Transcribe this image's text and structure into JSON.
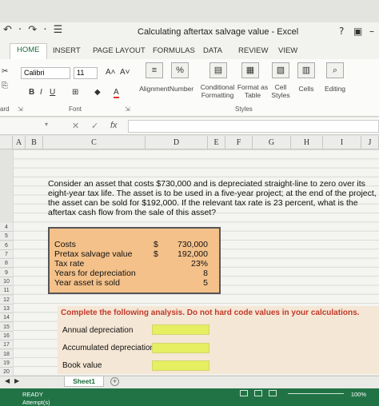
{
  "window": {
    "title": "Calculating aftertax salvage value - Excel",
    "help": "?",
    "qat_glyphs": "↶ · ↷ · ☰"
  },
  "ribbon": {
    "tabs": [
      "HOME",
      "INSERT",
      "PAGE LAYOUT",
      "FORMULAS",
      "DATA",
      "REVIEW",
      "VIEW"
    ],
    "font_name": "Calibri",
    "font_size": "11",
    "bold": "B",
    "italic": "I",
    "underline": "U",
    "grow_font": "A˄",
    "shrink_font": "A˅",
    "font_color": "A",
    "alignment": "Alignment",
    "number": "Number",
    "percent": "%",
    "conditional_formatting": "Conditional Formatting",
    "format_as_table": "Format as Table",
    "cell_styles": "Cell Styles",
    "cells": "Cells",
    "editing": "Editing",
    "group_font": "Font",
    "group_styles": "Styles",
    "group_clipboard": "ard"
  },
  "formula_bar": {
    "cancel": "✕",
    "enter": "✓",
    "fx": "fx"
  },
  "columns": [
    "A",
    "B",
    "C",
    "D",
    "E",
    "F",
    "G",
    "H",
    "I",
    "J"
  ],
  "rows": [
    "4",
    "5",
    "6",
    "7",
    "8",
    "9",
    "10",
    "11",
    "12",
    "13",
    "14",
    "15",
    "16",
    "17",
    "18",
    "19",
    "20"
  ],
  "problem_text": "Consider an asset that costs $730,000 and is depreciated straight-line to zero over its eight-year tax life. The asset is to be used in a five-year project; at the end of the project, the asset can be sold for $192,000. If the relevant tax rate is 23 percent, what is the aftertax cash flow from the sale of this asset?",
  "inputs": [
    {
      "label": "Costs",
      "sign": "$",
      "value": "730,000"
    },
    {
      "label": "Pretax salvage value",
      "sign": "$",
      "value": "192,000"
    },
    {
      "label": "Tax rate",
      "sign": "",
      "value": "23%"
    },
    {
      "label": "Years for depreciation",
      "sign": "",
      "value": "8"
    },
    {
      "label": "Year asset is sold",
      "sign": "",
      "value": "5"
    }
  ],
  "analysis": {
    "instruction": "Complete the following analysis. Do not hard code values in your calculations.",
    "items": [
      "Annual depreciation",
      "Accumulated depreciation",
      "Book value"
    ]
  },
  "sheet_tab": "Sheet1",
  "status": {
    "ready": "READY",
    "attempts": "Attempt(s)",
    "zoom": "100%"
  },
  "colors": {
    "excel_green": "#217346",
    "input_yellow": "#e6ef62",
    "data_box_orange": "#f4c18a",
    "instruction_red": "#c0392b"
  }
}
